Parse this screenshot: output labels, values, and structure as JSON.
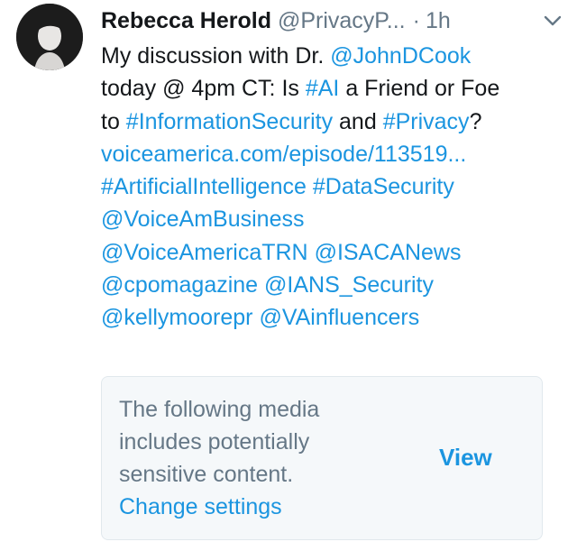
{
  "author": {
    "name": "Rebecca Herold",
    "handle": "@PrivacyP...",
    "separator": "·",
    "time": "1h"
  },
  "tweet": {
    "lines": [
      [
        {
          "text": "My discussion with Dr. ",
          "link": false
        },
        {
          "text": "@JohnDCook",
          "link": true
        }
      ],
      [
        {
          "text": "today @ 4pm CT: Is ",
          "link": false
        },
        {
          "text": "#AI",
          "link": true
        },
        {
          "text": " a Friend or Foe",
          "link": false
        }
      ],
      [
        {
          "text": "to ",
          "link": false
        },
        {
          "text": "#InformationSecurity",
          "link": true
        },
        {
          "text": " and ",
          "link": false
        },
        {
          "text": "#Privacy",
          "link": true
        },
        {
          "text": "?",
          "link": false
        }
      ],
      [
        {
          "text": "voiceamerica.com/episode/113519...",
          "link": true
        }
      ],
      [
        {
          "text": "#ArtificialIntelligence",
          "link": true
        },
        {
          "text": " ",
          "link": false
        },
        {
          "text": "#DataSecurity",
          "link": true
        }
      ],
      [
        {
          "text": "@VoiceAmBusiness",
          "link": true
        }
      ],
      [
        {
          "text": "@VoiceAmericaTRN",
          "link": true
        },
        {
          "text": " ",
          "link": false
        },
        {
          "text": "@ISACANews",
          "link": true
        }
      ],
      [
        {
          "text": "@cpomagazine",
          "link": true
        },
        {
          "text": " ",
          "link": false
        },
        {
          "text": "@IANS_Security",
          "link": true
        }
      ],
      [
        {
          "text": "@kellymoorepr",
          "link": true
        },
        {
          "text": " ",
          "link": false
        },
        {
          "text": "@VAinfluencers",
          "link": true
        }
      ]
    ]
  },
  "sensitive_media": {
    "message_lines": [
      "The following media",
      "includes potentially",
      "sensitive content."
    ],
    "change_settings_label": "Change settings",
    "view_label": "View"
  },
  "colors": {
    "link": "#1b95e0",
    "text": "#14171a",
    "secondary": "#657786",
    "card_background": "#f5f8fa"
  },
  "icons": {
    "menu": "chevron-down-icon",
    "avatar": "profile-photo"
  }
}
